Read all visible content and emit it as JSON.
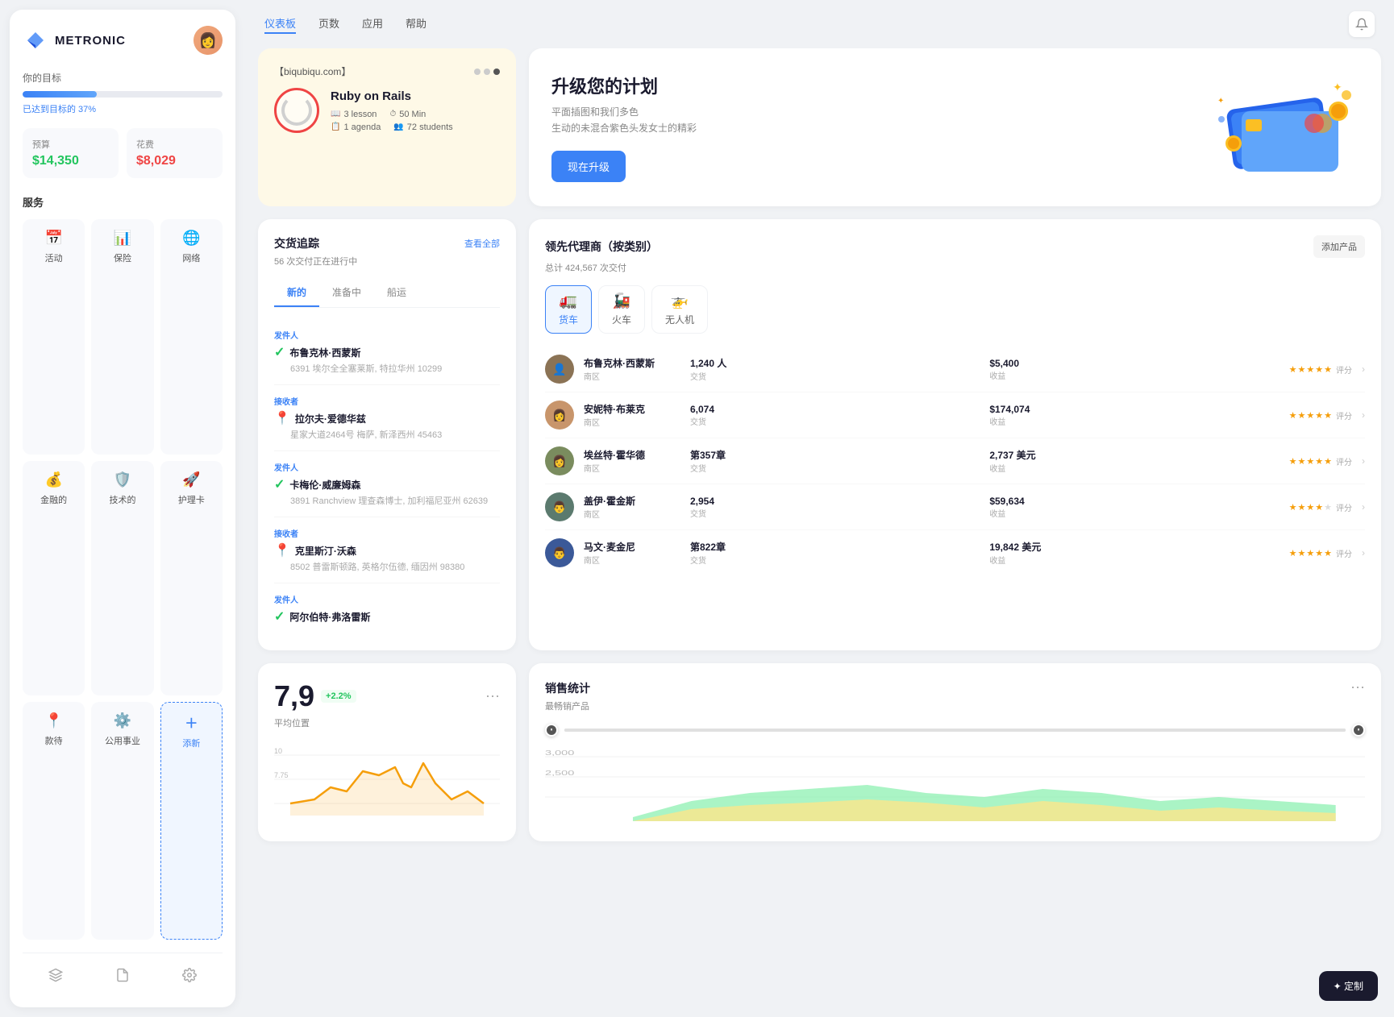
{
  "app": {
    "name": "METRONIC"
  },
  "nav": {
    "links": [
      "仪表板",
      "页数",
      "应用",
      "帮助"
    ],
    "active": "仪表板"
  },
  "sidebar": {
    "goal_label": "你的目标",
    "progress_percent": 37,
    "progress_text": "已达到目标的 37%",
    "budget_label": "预算",
    "budget_value": "$14,350",
    "spend_label": "花费",
    "spend_value": "$8,029",
    "services_title": "服务",
    "services": [
      {
        "label": "活动",
        "icon": "📅"
      },
      {
        "label": "保险",
        "icon": "📊"
      },
      {
        "label": "网络",
        "icon": "🌐"
      },
      {
        "label": "金融的",
        "icon": "💰"
      },
      {
        "label": "技术的",
        "icon": "🛡️"
      },
      {
        "label": "护理卡",
        "icon": "🚀"
      },
      {
        "label": "款待",
        "icon": "📍"
      },
      {
        "label": "公用事业",
        "icon": "⚙️"
      }
    ],
    "add_label": "添新",
    "footer_icons": [
      "layers",
      "file",
      "settings"
    ]
  },
  "course_card": {
    "url": "【biqubiqu.com】",
    "title": "Ruby on Rails",
    "lessons": "3 lesson",
    "duration": "50 Min",
    "agenda": "1 agenda",
    "students": "72 students"
  },
  "upgrade_card": {
    "title": "升级您的计划",
    "desc_line1": "平面插图和我们多色",
    "desc_line2": "生动的未混合紫色头发女士的精彩",
    "button_label": "现在升级"
  },
  "shipment": {
    "title": "交货追踪",
    "subtitle": "56 次交付正在进行中",
    "view_all": "查看全部",
    "tabs": [
      "新的",
      "准备中",
      "船运"
    ],
    "active_tab": "新的",
    "entries": [
      {
        "role": "发件人",
        "name": "布鲁克林·西蒙斯",
        "address": "6391 埃尔全全塞莱斯, 特拉华州 10299",
        "icon": "check"
      },
      {
        "role": "接收者",
        "name": "拉尔夫·爱德华兹",
        "address": "星家大道2464号 梅萨, 新泽西州 45463",
        "icon": "pin"
      },
      {
        "role": "发件人",
        "name": "卡梅伦·威廉姆森",
        "address": "3891 Ranchview 理查森博士, 加利福尼亚州 62639",
        "icon": "check"
      },
      {
        "role": "接收者",
        "name": "克里斯汀·沃森",
        "address": "8502 普雷斯顿路, 英格尔伍德, 缅因州 98380",
        "icon": "pin"
      },
      {
        "role": "发件人",
        "name": "阿尔伯特·弗洛雷斯",
        "address": "",
        "icon": "check"
      }
    ]
  },
  "agents": {
    "title": "领先代理商（按类别）",
    "subtitle": "总计 424,567 次交付",
    "add_product": "添加产品",
    "categories": [
      "货车",
      "火车",
      "无人机"
    ],
    "active_category": "货车",
    "rows": [
      {
        "name": "布鲁克林·西蒙斯",
        "region": "南区",
        "transactions": "1,240 人",
        "trans_label": "交货",
        "revenue": "$5,400",
        "rev_label": "收益",
        "rating": 5,
        "rating_label": "评分",
        "avatar_color": "#8B7355"
      },
      {
        "name": "安妮特·布莱克",
        "region": "南区",
        "transactions": "6,074",
        "trans_label": "交货",
        "revenue": "$174,074",
        "rev_label": "收益",
        "rating": 5,
        "rating_label": "评分",
        "avatar_color": "#c8956b"
      },
      {
        "name": "埃丝特·霍华德",
        "region": "南区",
        "transactions": "第357章",
        "trans_label": "交货",
        "revenue": "2,737 美元",
        "rev_label": "收益",
        "rating": 5,
        "rating_label": "评分",
        "avatar_color": "#7a8c5e"
      },
      {
        "name": "盖伊·霍金斯",
        "region": "南区",
        "transactions": "2,954",
        "trans_label": "交货",
        "revenue": "$59,634",
        "rev_label": "收益",
        "rating": 4,
        "rating_label": "评分",
        "avatar_color": "#5b7a6e"
      },
      {
        "name": "马文·麦金尼",
        "region": "南区",
        "transactions": "第822章",
        "trans_label": "交货",
        "revenue": "19,842 美元",
        "rev_label": "收益",
        "rating": 5,
        "rating_label": "评分",
        "avatar_color": "#3b5998"
      }
    ]
  },
  "avg_position": {
    "value": "7,9",
    "trend": "+2.2%",
    "label": "平均位置"
  },
  "sales_stats": {
    "title": "销售统计",
    "subtitle": "最畅销产品"
  },
  "customize_btn": "✦ 定制"
}
